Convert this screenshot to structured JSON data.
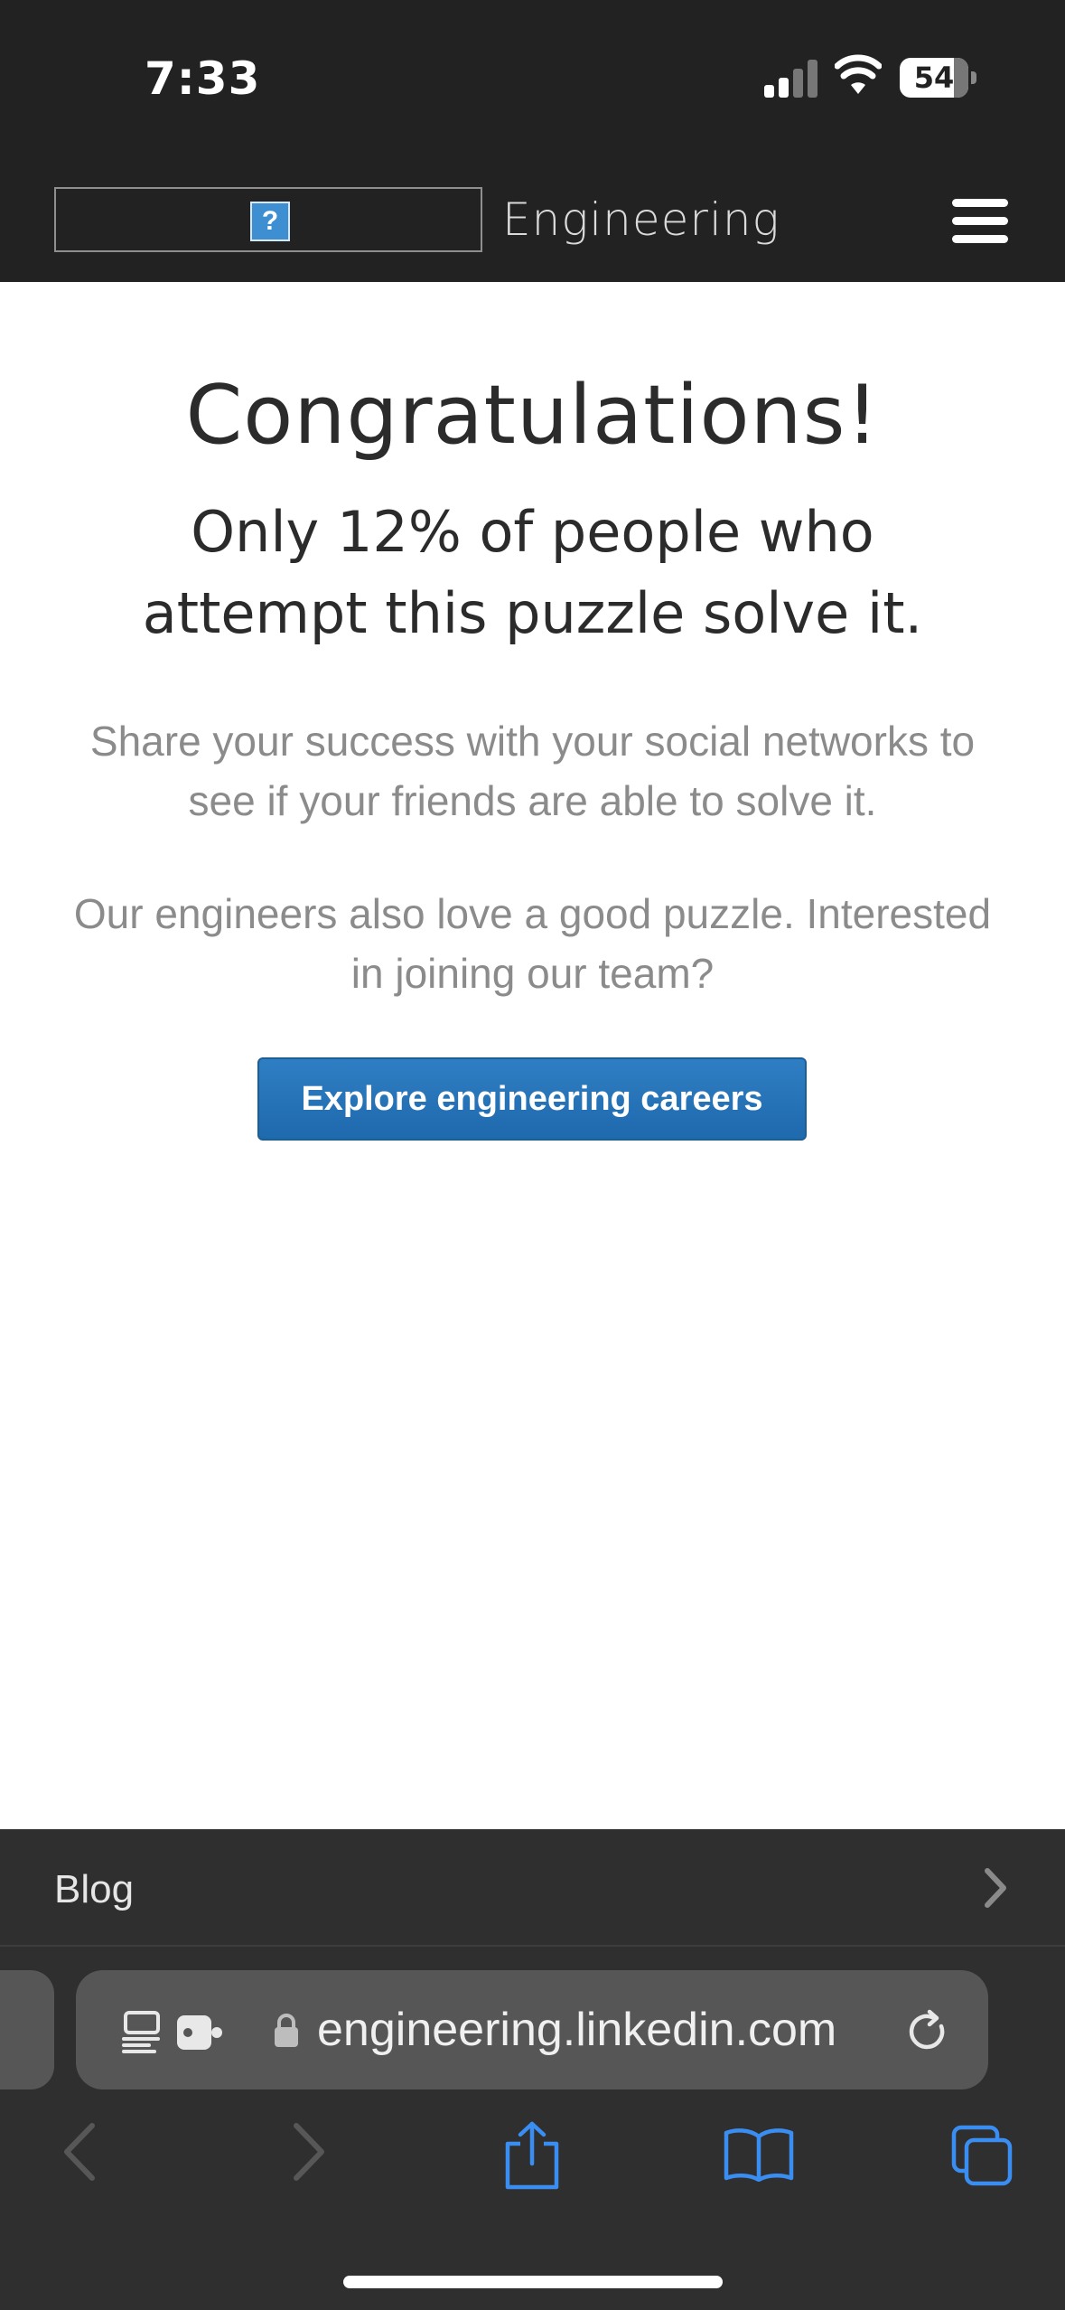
{
  "status_bar": {
    "time": "7:33",
    "battery_level": "54"
  },
  "site_header": {
    "site_name": "Engineering",
    "logo_icon": "broken-image-icon"
  },
  "main": {
    "title": "Congratulations!",
    "subtitle": "Only 12% of people who attempt this puzzle solve it.",
    "share_text": "Share your success with your social networks to see if your friends are able to solve it.",
    "join_text": "Our engineers also love a good puzzle. Interested in joining our team?",
    "cta_label": "Explore engineering careers"
  },
  "browser": {
    "blog_label": "Blog",
    "url": "engineering.linkedin.com",
    "accent_color": "#3a8ef2"
  }
}
